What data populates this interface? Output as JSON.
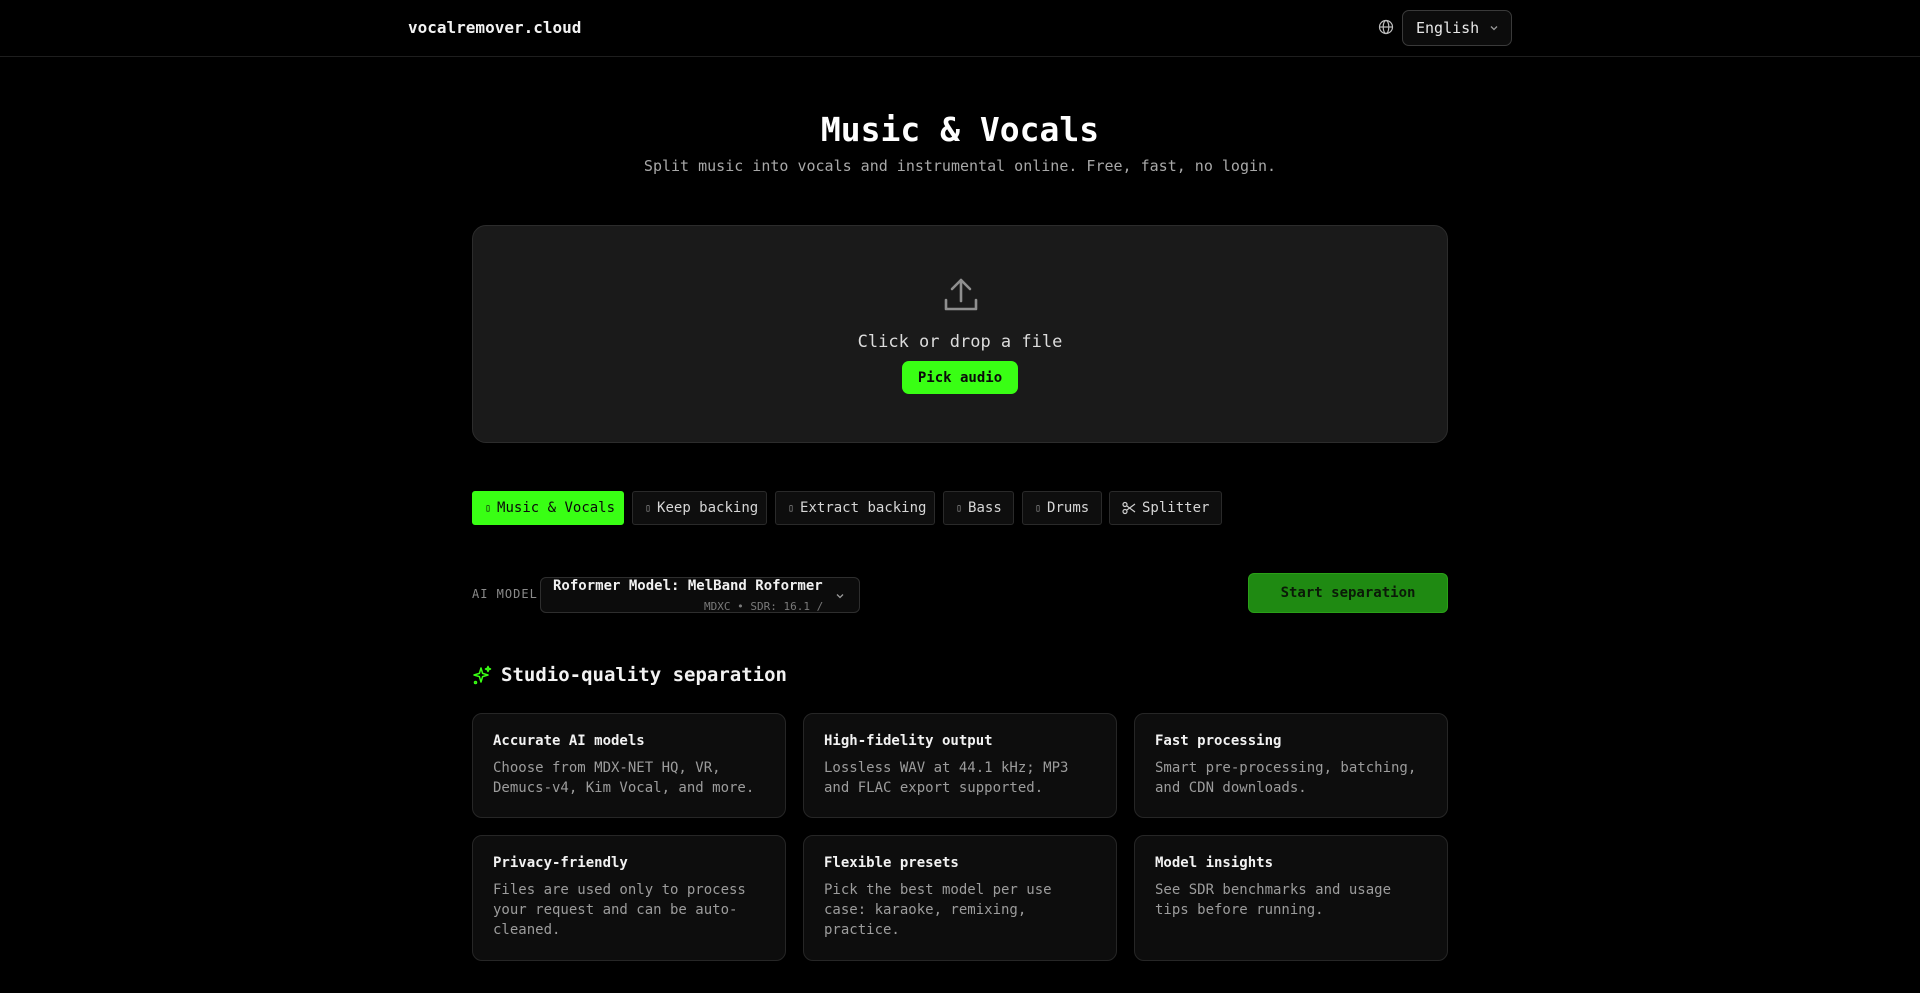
{
  "header": {
    "brand": "vocalremover.cloud",
    "language": "English"
  },
  "hero": {
    "title": "Music & Vocals",
    "subtitle": "Split music into vocals and instrumental online. Free, fast, no login."
  },
  "upload": {
    "prompt": "Click or drop a file",
    "button_label": "Pick audio"
  },
  "tabs": [
    {
      "label": "Music & Vocals",
      "icon": "music-icon",
      "active": true
    },
    {
      "label": "Keep backing",
      "icon": "music-icon",
      "active": false
    },
    {
      "label": "Extract backing",
      "icon": "music-icon",
      "active": false
    },
    {
      "label": "Bass",
      "icon": "music-icon",
      "active": false
    },
    {
      "label": "Drums",
      "icon": "music-icon",
      "active": false
    },
    {
      "label": "Splitter",
      "icon": "scissors-icon",
      "active": false
    }
  ],
  "model": {
    "label": "AI MODEL",
    "selected": "Roformer Model: MelBand Roformer",
    "meta": "MDXC • SDR: 16.1 /"
  },
  "actions": {
    "start_label": "Start separation"
  },
  "features": {
    "heading": "Studio-quality separation",
    "cards": [
      {
        "title": "Accurate AI models",
        "text": "Choose from MDX-NET HQ, VR, Demucs-v4, Kim Vocal, and more."
      },
      {
        "title": "High-fidelity output",
        "text": "Lossless WAV at 44.1 kHz; MP3 and FLAC export supported."
      },
      {
        "title": "Fast processing",
        "text": "Smart pre-processing, batching, and CDN downloads."
      },
      {
        "title": "Privacy-friendly",
        "text": "Files are used only to process your request and can be auto-cleaned."
      },
      {
        "title": "Flexible presets",
        "text": "Pick the best model per use case: karaoke, remixing, practice."
      },
      {
        "title": "Model insights",
        "text": "See SDR benchmarks and usage tips before running."
      }
    ]
  },
  "colors": {
    "accent": "#39ff14",
    "start_button": "#1f8a12",
    "background": "#000000",
    "card": "#0d0d0d"
  }
}
